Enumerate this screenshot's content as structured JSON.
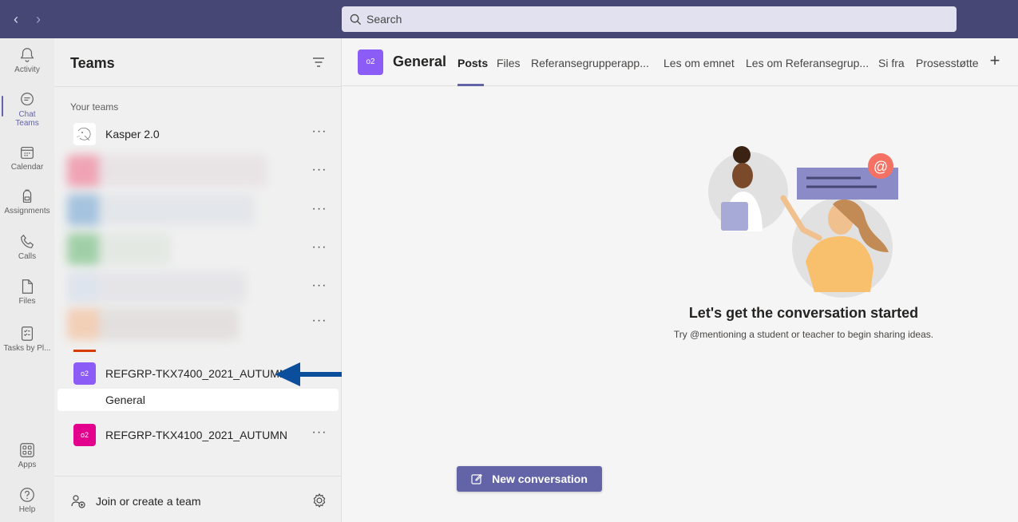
{
  "topbar": {
    "search_placeholder": "Search"
  },
  "rail": {
    "items": [
      {
        "label": "Activity"
      },
      {
        "label": "Chat"
      },
      {
        "label": "Teams"
      },
      {
        "label": "Calendar"
      },
      {
        "label": "Assignments"
      },
      {
        "label": "Calls"
      },
      {
        "label": "Files"
      },
      {
        "label": "Tasks by Pl..."
      },
      {
        "label": "Apps"
      },
      {
        "label": "Help"
      }
    ]
  },
  "teams_panel": {
    "title": "Teams",
    "section_label": "Your teams",
    "teams": [
      {
        "name": "Kasper 2.0",
        "avatar": ""
      },
      {
        "name": "REFGRP-TKX7400_2021_AUTUMN",
        "avatar": "o2",
        "color": "#8b5cf6"
      },
      {
        "name": "REFGRP-TKX4100_2021_AUTUMN",
        "avatar": "o2",
        "color": "#e3008c"
      }
    ],
    "selected_channel": "General",
    "join_label": "Join or create a team"
  },
  "channel": {
    "avatar": "o2",
    "title": "General",
    "tabs": [
      {
        "label": "Posts",
        "active": true
      },
      {
        "label": "Files"
      },
      {
        "label": "Referansegrupperapp..."
      },
      {
        "label": "Les om emnet"
      },
      {
        "label": "Les om Referansegrup..."
      },
      {
        "label": "Si fra"
      },
      {
        "label": "Prosesstøtte"
      }
    ],
    "empty_title": "Let's get the conversation started",
    "empty_subtitle": "Try @mentioning a student or teacher to begin sharing ideas.",
    "new_conversation_label": "New conversation"
  },
  "colors": {
    "topbar": "#464775",
    "accent": "#6264a7",
    "annotation_arrow": "#0b4f9c"
  }
}
